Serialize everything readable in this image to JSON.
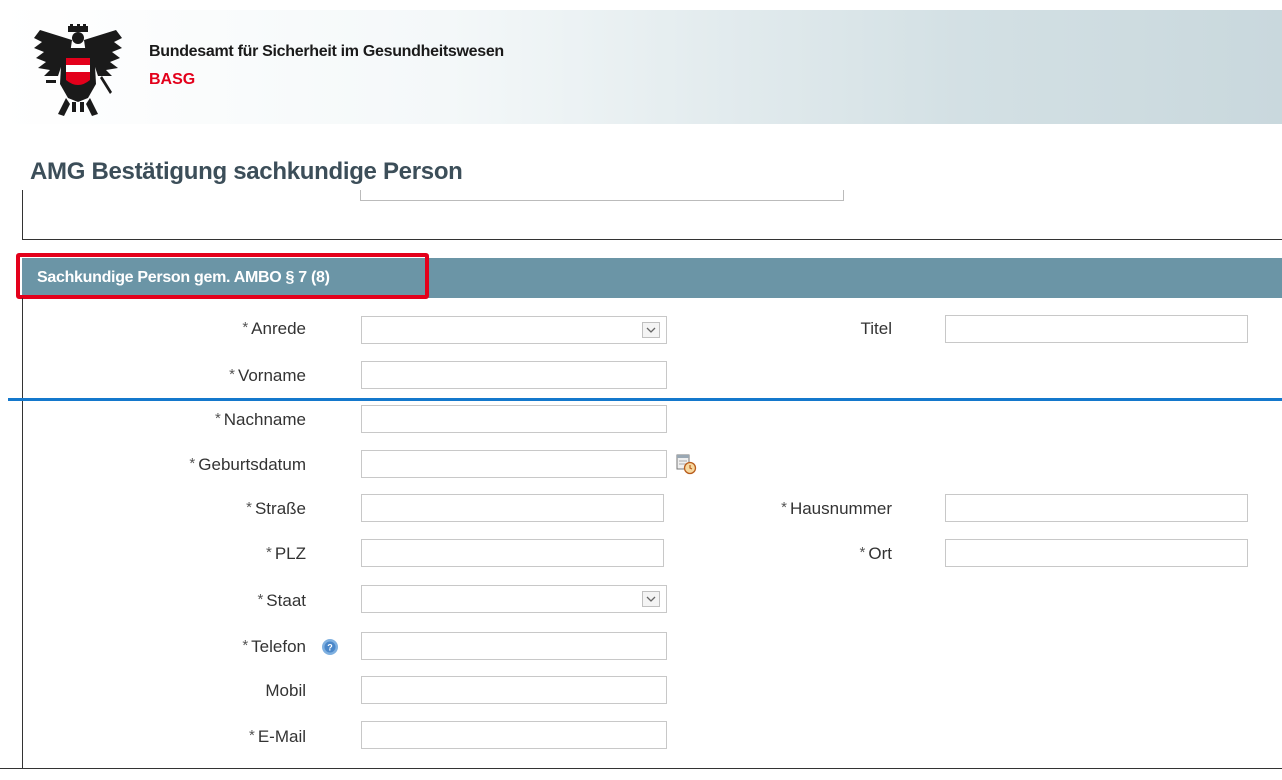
{
  "header": {
    "org_name": "Bundesamt für Sicherheit im Gesundheitswesen",
    "org_abbr": "BASG",
    "logo_icon": "austrian-eagle-icon",
    "accent_color": "#e3001b"
  },
  "page": {
    "title": "AMG Bestätigung sachkundige Person"
  },
  "section": {
    "title": "Sachkundige Person gem. AMBO § 7 (8)",
    "bar_color": "#6b95a6"
  },
  "form": {
    "required_marker": "*",
    "fields": {
      "anrede": {
        "label": "Anrede",
        "required": true,
        "value": ""
      },
      "titel": {
        "label": "Titel",
        "required": false,
        "value": ""
      },
      "vorname": {
        "label": "Vorname",
        "required": true,
        "value": ""
      },
      "nachname": {
        "label": "Nachname",
        "required": true,
        "value": ""
      },
      "geburtsdatum": {
        "label": "Geburtsdatum",
        "required": true,
        "value": "",
        "icon": "calendar-clock-icon"
      },
      "strasse": {
        "label": "Straße",
        "required": true,
        "value": ""
      },
      "hausnummer": {
        "label": "Hausnummer",
        "required": true,
        "value": ""
      },
      "plz": {
        "label": "PLZ",
        "required": true,
        "value": ""
      },
      "ort": {
        "label": "Ort",
        "required": true,
        "value": ""
      },
      "staat": {
        "label": "Staat",
        "required": true,
        "value": ""
      },
      "telefon": {
        "label": "Telefon",
        "required": true,
        "value": "",
        "icon": "help-icon"
      },
      "mobil": {
        "label": "Mobil",
        "required": false,
        "value": ""
      },
      "email": {
        "label": "E-Mail",
        "required": true,
        "value": ""
      }
    }
  }
}
